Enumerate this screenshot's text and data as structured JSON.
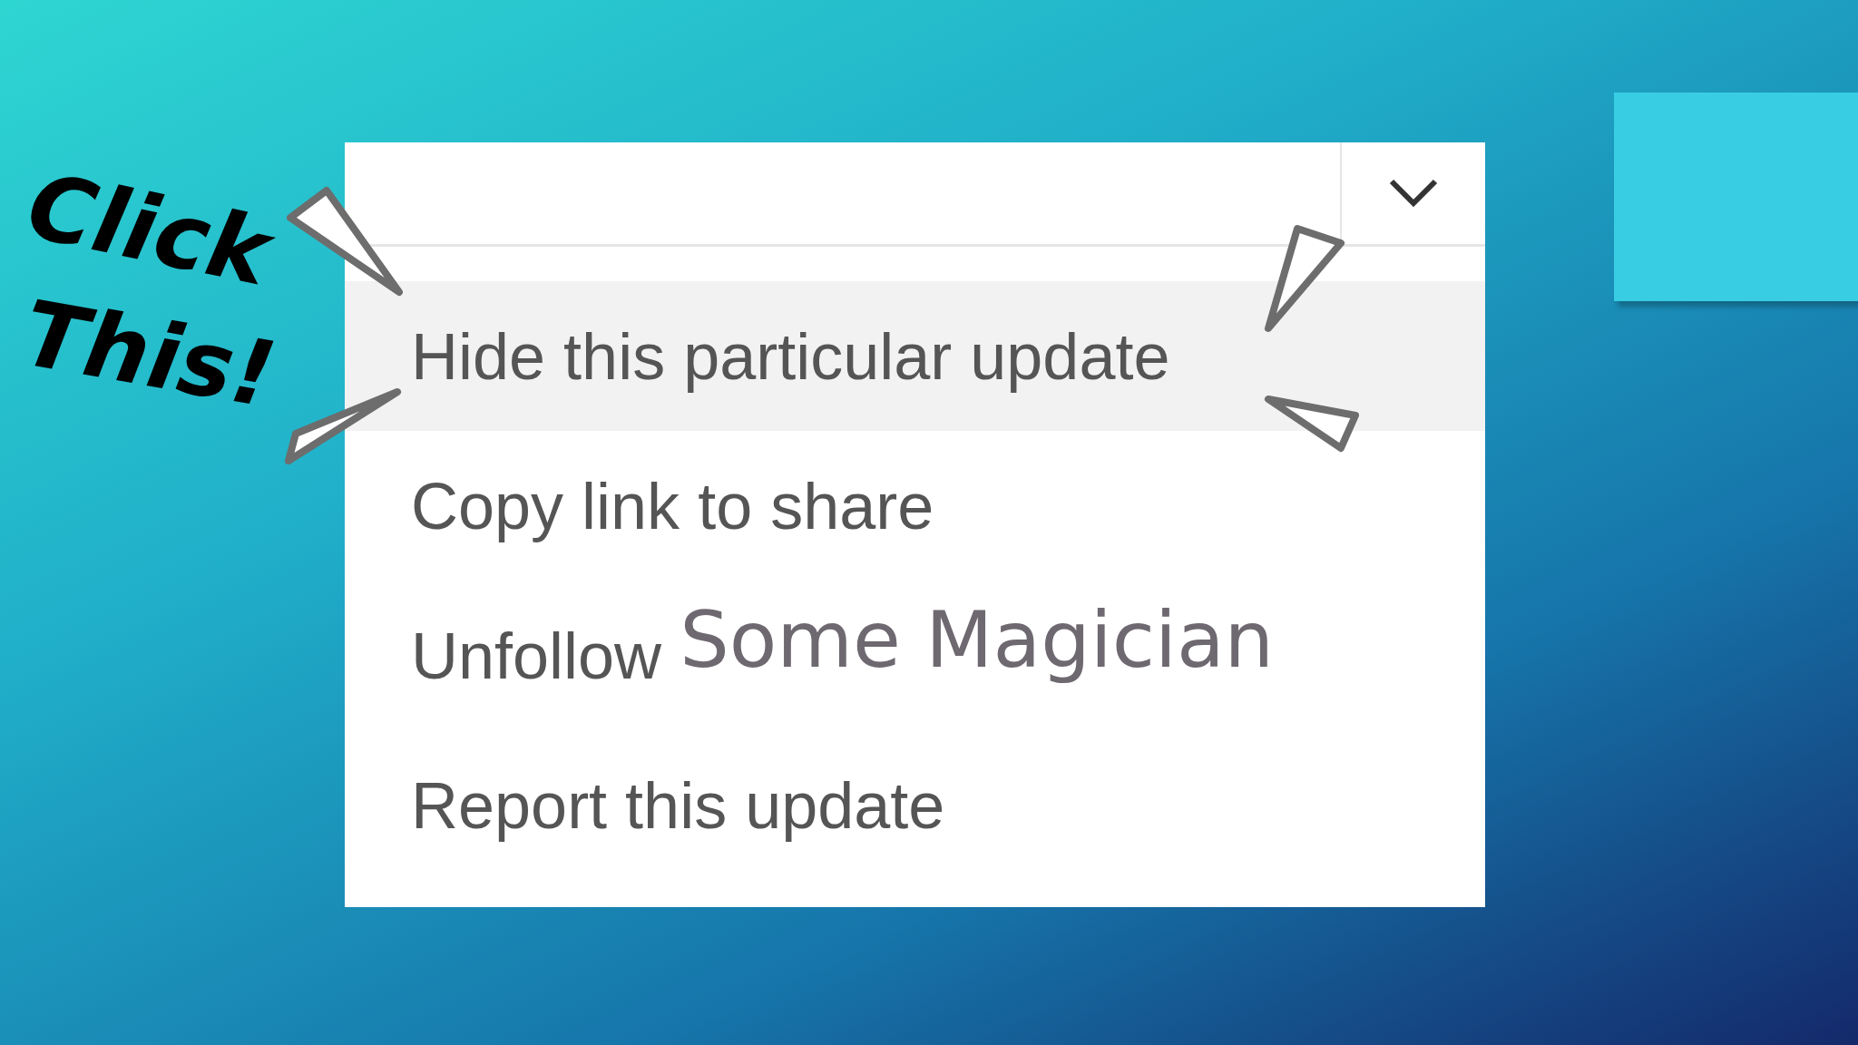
{
  "callout": {
    "lines": [
      "Click",
      "This!"
    ]
  },
  "menu": {
    "items": [
      {
        "label": "Hide this particular update",
        "selected": true
      },
      {
        "label": "Copy link to share",
        "selected": false
      },
      {
        "label": "Unfollow",
        "selected": false,
        "name_overlay": "Some Magician"
      },
      {
        "label": "Report this update",
        "selected": false
      }
    ]
  }
}
